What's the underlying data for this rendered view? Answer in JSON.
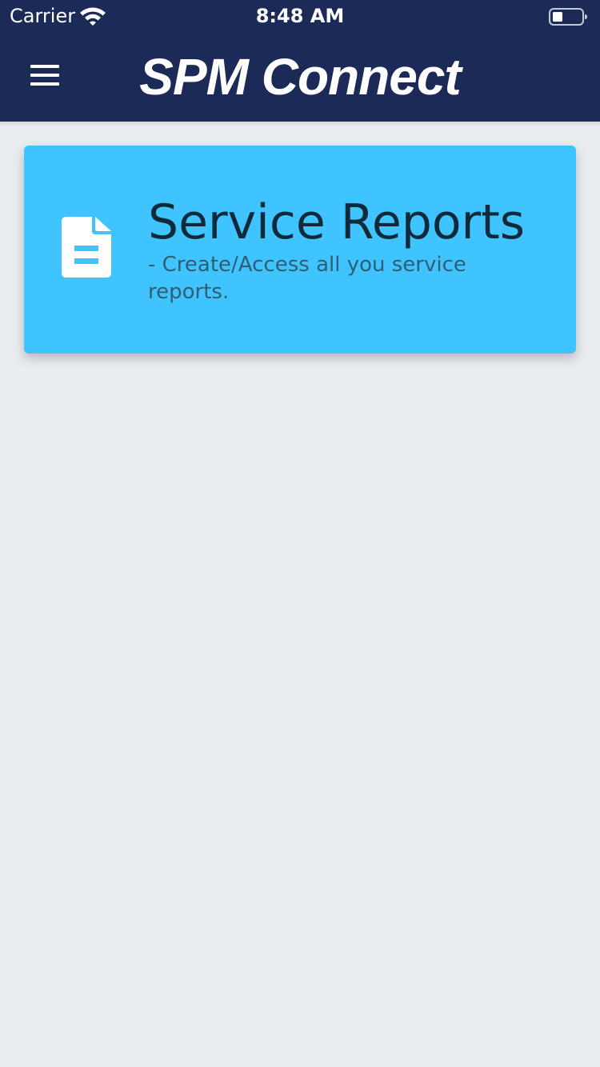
{
  "status_bar": {
    "carrier": "Carrier",
    "time": "8:48 AM",
    "wifi_icon": "wifi-icon",
    "battery_icon": "battery-icon"
  },
  "header": {
    "title": "SPM Connect",
    "menu_icon": "hamburger-menu-icon",
    "background_color": "#1b2a57"
  },
  "cards": [
    {
      "title": "Service Reports",
      "subtitle": "- Create/Access all you service reports.",
      "icon": "document-icon",
      "background_color": "#40c4ff"
    }
  ],
  "page": {
    "background_color": "#e9edf0"
  }
}
